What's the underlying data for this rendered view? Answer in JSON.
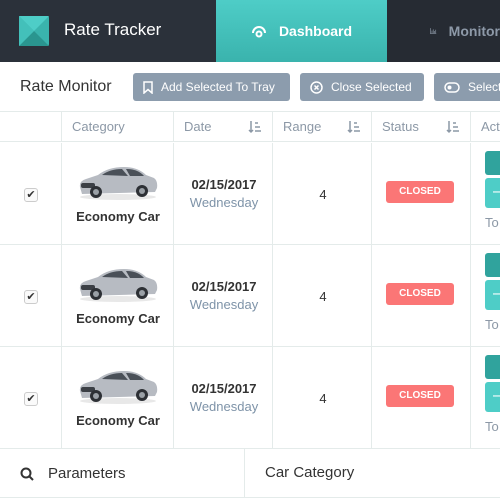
{
  "app": {
    "title": "Rate Tracker"
  },
  "nav": {
    "dashboard": "Dashboard",
    "monitor": "Monitor"
  },
  "toolbar": {
    "title": "Rate Monitor",
    "add_to_tray": "Add Selected To Tray",
    "close_selected": "Close Selected",
    "select": "Select"
  },
  "table": {
    "headers": [
      "",
      "Category",
      "Date",
      "Range",
      "Status",
      "Actions"
    ],
    "rows": [
      {
        "checked": "✔",
        "category": "Economy Car",
        "date": "02/15/2017",
        "day": "Wednesday",
        "range": "4",
        "status": "CLOSED",
        "action_text": "To"
      },
      {
        "checked": "✔",
        "category": "Economy Car",
        "date": "02/15/2017",
        "day": "Wednesday",
        "range": "4",
        "status": "CLOSED",
        "action_text": "To"
      },
      {
        "checked": "✔",
        "category": "Economy Car",
        "date": "02/15/2017",
        "day": "Wednesday",
        "range": "4",
        "status": "CLOSED",
        "action_text": "To"
      }
    ]
  },
  "footer": {
    "parameters": "Parameters",
    "car_category": "Car Category"
  },
  "colors": {
    "accent": "#4ecdc7",
    "topbar": "#2b313a",
    "status_closed": "#fb7676",
    "button_gray": "#8c9cad"
  }
}
